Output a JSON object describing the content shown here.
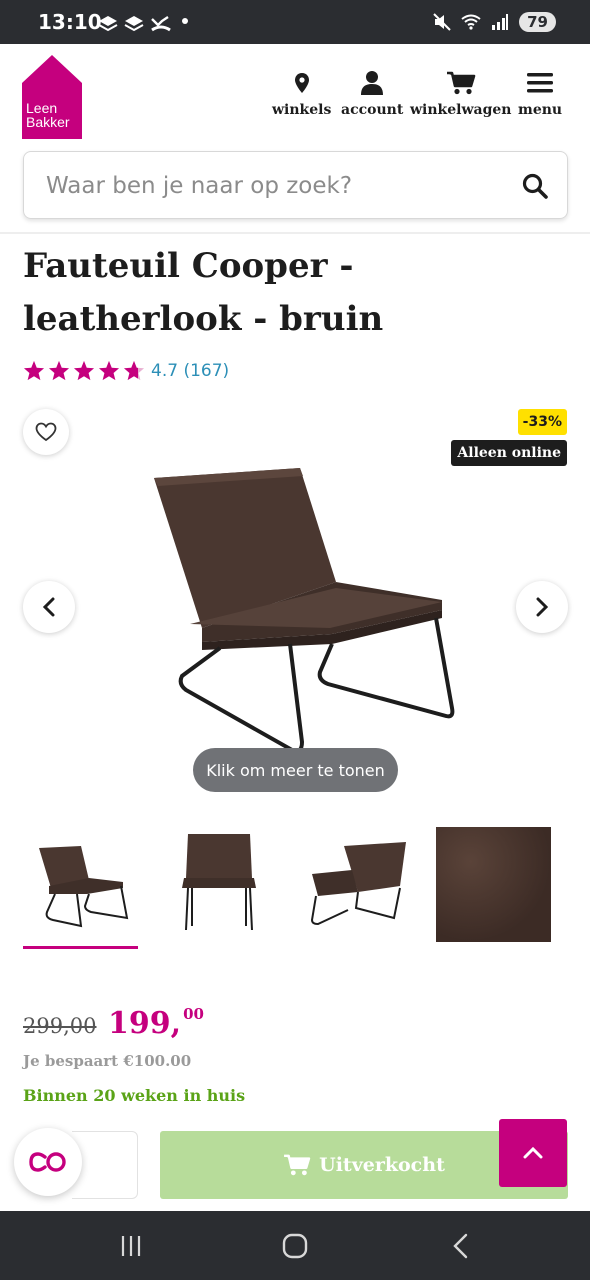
{
  "status_bar": {
    "time": "13:10",
    "battery": "79"
  },
  "header": {
    "logo_line1": "Leen",
    "logo_line2": "Bakker",
    "nav": [
      {
        "label": "winkels",
        "icon": "map-pin-icon"
      },
      {
        "label": "account",
        "icon": "user-icon"
      },
      {
        "label": "winkelwagen",
        "icon": "cart-icon"
      },
      {
        "label": "menu",
        "icon": "hamburger-icon"
      }
    ]
  },
  "search": {
    "placeholder": "Waar ben je naar op zoek?"
  },
  "product": {
    "title": "Fauteuil Cooper - leatherlook - bruin",
    "rating": 4.7,
    "rating_text": "4.7 (167)",
    "discount_badge": "-33%",
    "online_badge": "Alleen online",
    "show_more": "Klik om meer te tonen",
    "old_price": "299,00",
    "new_price_main": "199,",
    "new_price_cents": "00",
    "saving": "Je bespaart €100.00",
    "delivery": "Binnen 20 weken in huis",
    "sold_out_label": "Uitverkocht"
  },
  "colors": {
    "brand": "#c5007e",
    "link": "#2c8fb7",
    "discount": "#ffe000",
    "delivery": "#5aa317",
    "sold_out": "#b7dc9a"
  }
}
